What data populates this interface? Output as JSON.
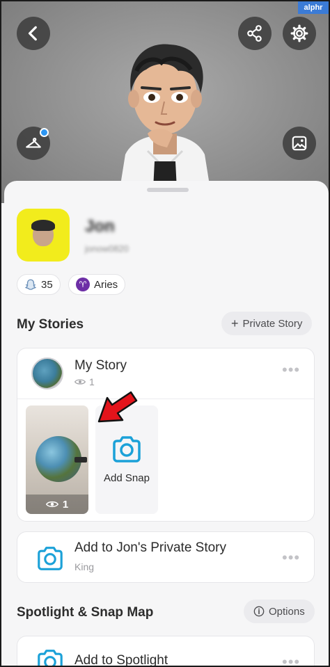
{
  "watermark": "alphr",
  "header": {
    "back_icon": "chevron-left-icon",
    "share_icon": "share-icon",
    "settings_icon": "gear-icon",
    "outfit_icon": "hanger-icon",
    "photo_icon": "image-icon",
    "notification_dot_color": "#2d96f2"
  },
  "profile": {
    "name": "Jon",
    "username": "jonow0820",
    "snapcode_color": "#f2ec1c",
    "friend_count": "35",
    "zodiac": "Aries",
    "zodiac_symbol": "♈"
  },
  "my_stories": {
    "title": "My Stories",
    "private_story_button": "Private Story",
    "story": {
      "title": "My Story",
      "views": "1"
    },
    "snap_thumbnail_views": "1",
    "add_snap_label": "Add Snap"
  },
  "private_story": {
    "title": "Add to Jon's Private Story",
    "subtitle": "King"
  },
  "spotlight": {
    "title": "Spotlight & Snap Map",
    "options_button": "Options",
    "add_to_spotlight": "Add to Spotlight"
  },
  "colors": {
    "accent_blue": "#1ba1d8",
    "arrow_red": "#e3141b",
    "aries_purple": "#6d2fa6"
  }
}
